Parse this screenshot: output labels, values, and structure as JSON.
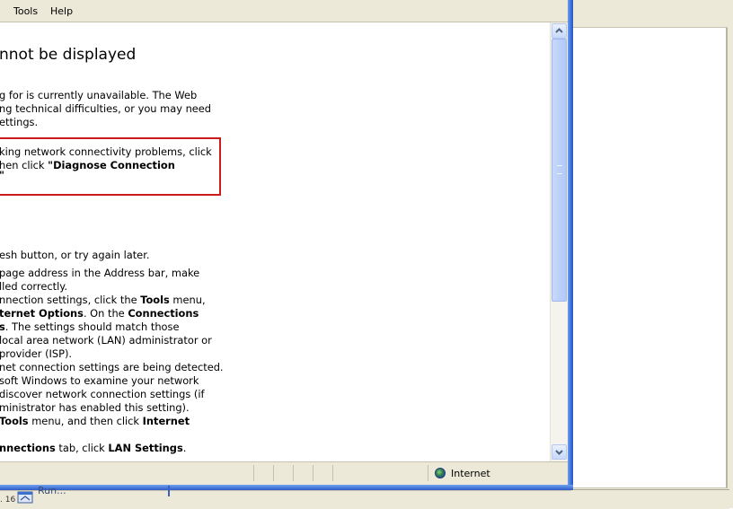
{
  "menubar": {
    "items": [
      "Tools",
      "Help"
    ]
  },
  "page": {
    "heading": "nnot be displayed",
    "intro_lines": [
      "g for is currently unavailable. The Web",
      "ng technical difficulties, or you may need",
      "ettings."
    ],
    "diagnose_lines": [
      "king network connectivity problems, click",
      "hen click ",
      "\"Diagnose Connection"
    ],
    "diagnose_tail": "\"",
    "steps": {
      "refresh": "esh button, or try again later.",
      "address_1": "page address in the Address bar, make",
      "address_2": "lled correctly.",
      "conn_1a": "nnection settings, click the ",
      "conn_1b": "Tools",
      "conn_1c": " menu,",
      "conn_2a": "ternet Options",
      "conn_2b": ". On the ",
      "conn_2c": "Connections",
      "conn_3a": "s",
      "conn_3b": ". The settings should match those",
      "conn_4": " local area network (LAN) administrator or",
      "conn_5": "provider (ISP).",
      "detect_1": "net connection settings are being detected.",
      "detect_2": "soft Windows to examine your network",
      "detect_3": " discover network connection settings (if",
      "detect_4": "ministrator has enabled this setting).",
      "tools_1a": "Tools",
      "tools_1b": " menu, and then click ",
      "tools_1c": "Internet",
      "lan_1a": "nnections",
      "lan_1b": " tab, click ",
      "lan_1c": "LAN Settings",
      "lan_1d": "."
    }
  },
  "statusbar": {
    "zone_label": "Internet",
    "zone_icon": "globe-icon"
  },
  "taskbar": {
    "number_fragment": ". 16",
    "run_label": "Run..."
  },
  "colors": {
    "highlight_border": "#cc1b1b",
    "window_frame": "#2d5cc6"
  }
}
